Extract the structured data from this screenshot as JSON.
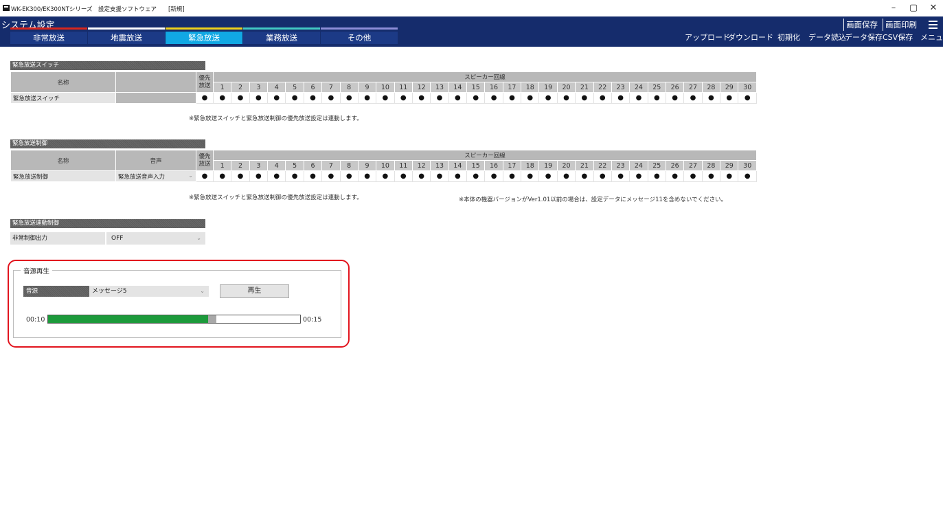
{
  "window": {
    "title": "WK-EK300/EK300NTシリーズ　設定支援ソフトウェア　　[新規]",
    "minimize": "–",
    "restore": "▢",
    "close": "✕"
  },
  "header": {
    "system_title": "システム設定",
    "tabs": [
      {
        "label": "非常放送",
        "color": "#d9261c",
        "active": false
      },
      {
        "label": "地震放送",
        "color": "#ffffff",
        "active": false
      },
      {
        "label": "緊急放送",
        "color": "#f1d21a",
        "active": true
      },
      {
        "label": "業務放送",
        "color": "#42c9c3",
        "active": false
      },
      {
        "label": "その他",
        "color": "#8e8ed8",
        "active": false
      }
    ],
    "top_buttons": [
      "画面保存",
      "画面印刷"
    ],
    "buttons": [
      "アップロード",
      "ダウンロード",
      "初期化",
      "データ読込",
      "データ保存",
      "CSV保存",
      "メニュー"
    ]
  },
  "switch_section": {
    "title": "緊急放送スイッチ",
    "col_name": "名称",
    "col_priority": "優先\n放送",
    "speaker_title": "スピーカー回線",
    "numbers": [
      "1",
      "2",
      "3",
      "4",
      "5",
      "6",
      "7",
      "8",
      "9",
      "10",
      "11",
      "12",
      "13",
      "14",
      "15",
      "16",
      "17",
      "18",
      "19",
      "20",
      "21",
      "22",
      "23",
      "24",
      "25",
      "26",
      "27",
      "28",
      "29",
      "30"
    ],
    "row_name": "緊急放送スイッチ",
    "dot": "●",
    "note": "※緊急放送スイッチと緊急放送制御の優先放送設定は連動します。"
  },
  "control_section": {
    "title": "緊急放送制御",
    "col_name": "名称",
    "col_voice": "音声",
    "col_priority": "優先\n放送",
    "speaker_title": "スピーカー回線",
    "row_name": "緊急放送制御",
    "voice_value": "緊急放送音声入力",
    "dot": "●",
    "note": "※緊急放送スイッチと緊急放送制御の優先放送設定は連動します。",
    "note2": "※本体の機器バージョンがVer1.01以前の場合は、設定データにメッセージ11を含めないでください。"
  },
  "link_section": {
    "title": "緊急放送連動制御",
    "label": "非常制御出力",
    "value": "OFF"
  },
  "playback": {
    "legend": "音源再生",
    "source_label": "音源",
    "source_value": "メッセージ5",
    "play_label": "再生",
    "time_current": "00:10",
    "time_total": "00:15",
    "progress_fraction": 0.667
  }
}
